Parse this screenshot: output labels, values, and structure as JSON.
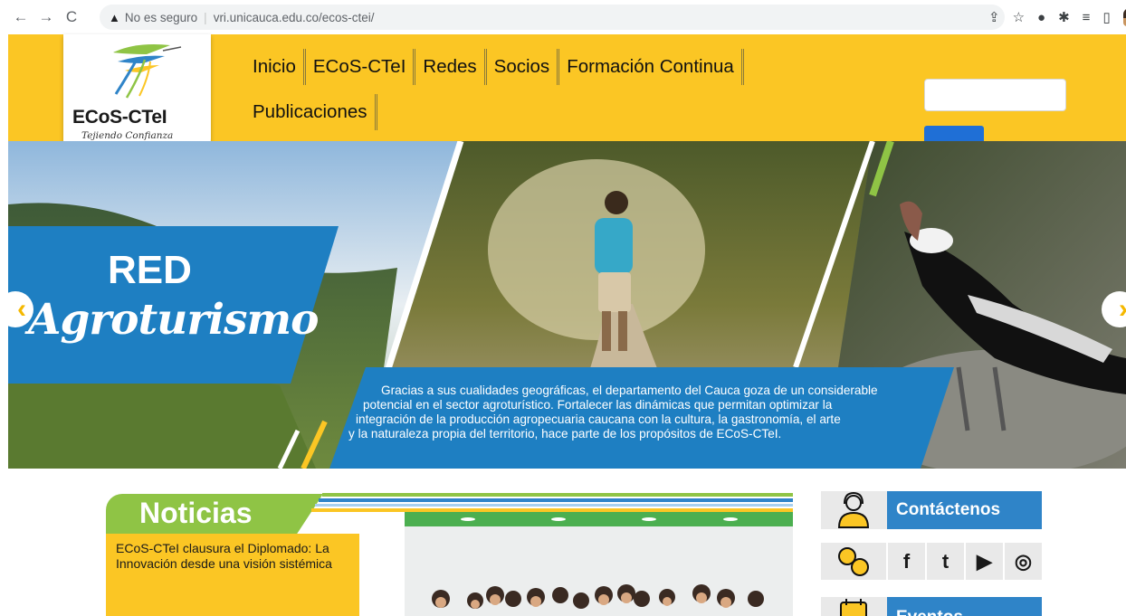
{
  "browser": {
    "back": "←",
    "forward": "→",
    "reload": "C",
    "security_label": "No es seguro",
    "separator": "|",
    "url": "vri.unicauca.edu.co/ecos-ctei/"
  },
  "site": {
    "logo_title": "ECoS-CTeI",
    "logo_tagline": "Tejiendo Confianza",
    "nav": [
      "Inicio",
      "ECoS-CTeI",
      "Redes",
      "Socios",
      "Formación Continua",
      "Publicaciones"
    ],
    "search_placeholder": ""
  },
  "hero": {
    "title_1": "RED",
    "title_2": "Agroturismo",
    "text_lines": [
      "Gracias a sus cualidades geográficas, el departamento del Cauca goza de un considerable",
      "potencial en el sector agroturístico. Fortalecer las dinámicas que permitan optimizar la",
      "integración de la producción agropecuaria caucana con la  cultura, la gastronomía, el arte",
      "y la naturaleza propia del territorio, hace parte de los propósitos de ECoS-CTeI."
    ],
    "prev_arrow": "‹",
    "next_arrow": "›"
  },
  "news": {
    "section_title": "Noticias",
    "headline": "ECoS-CTeI clausura el Diplomado: La Innovación desde una visión sistémica"
  },
  "sidebar": {
    "contact_label": "Contáctenos",
    "events_label": "Eventos",
    "social": [
      "f",
      "t",
      "▶",
      "◎"
    ]
  },
  "colors": {
    "header_yellow": "#fbc624",
    "hero_blue": "#1e7fc2",
    "noticias_green": "#8fc445",
    "sidebar_blue": "#2f84c8"
  }
}
